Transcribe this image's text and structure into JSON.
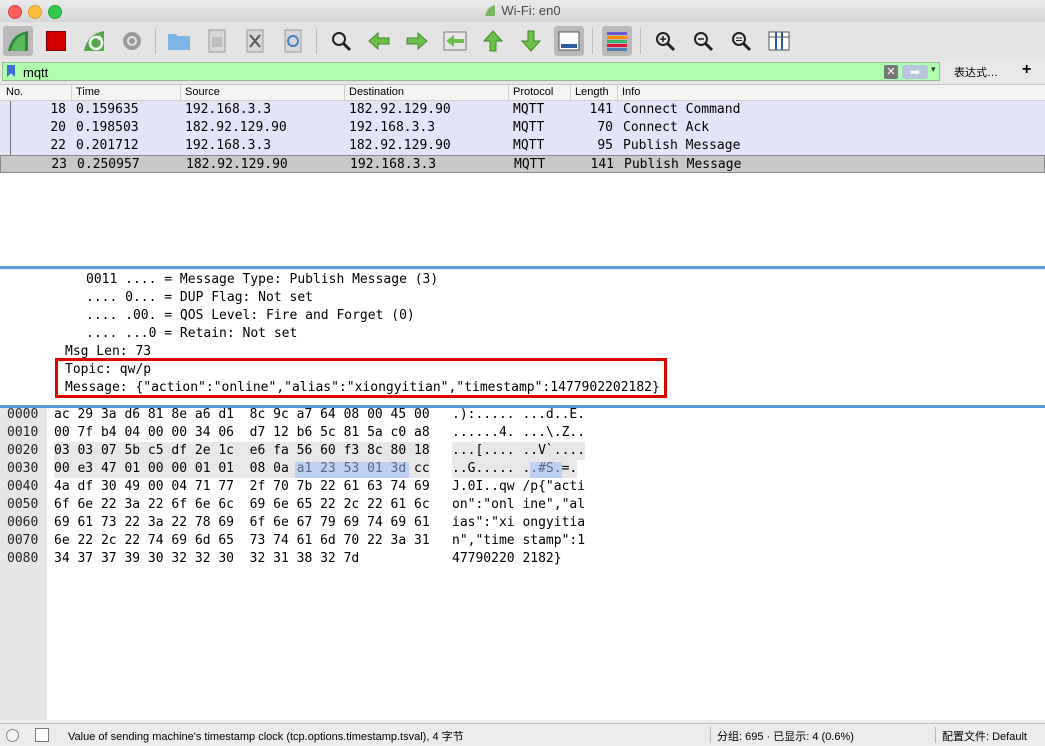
{
  "window": {
    "title": "Wi-Fi: en0"
  },
  "toolbar": {
    "icons": [
      "shark-fin-start-icon",
      "stop-square-icon",
      "restart-icon",
      "capture-options-gear-icon",
      "open-folder-icon",
      "save-file-icon",
      "close-file-icon",
      "reload-icon",
      "find-magnifier-icon",
      "go-back-arrow-icon",
      "go-forward-arrow-icon",
      "go-to-packet-icon",
      "go-first-icon",
      "go-last-icon",
      "autoscroll-icon",
      "colorize-icon",
      "zoom-in-icon",
      "zoom-out-icon",
      "zoom-normal-icon",
      "resize-columns-icon"
    ]
  },
  "filter": {
    "value": "mqtt",
    "expression_label": "表达式…",
    "add_label": "+",
    "clear_label": "✕",
    "apply_label": "➡",
    "recent_label": "▾"
  },
  "columns": [
    "No.",
    "Time",
    "Source",
    "Destination",
    "Protocol",
    "Length",
    "Info"
  ],
  "packets": [
    {
      "no": "18",
      "time": "0.159635",
      "source": "192.168.3.3",
      "destination": "182.92.129.90",
      "protocol": "MQTT",
      "length": "141",
      "info": "Connect Command"
    },
    {
      "no": "20",
      "time": "0.198503",
      "source": "182.92.129.90",
      "destination": "192.168.3.3",
      "protocol": "MQTT",
      "length": "70",
      "info": "Connect Ack"
    },
    {
      "no": "22",
      "time": "0.201712",
      "source": "192.168.3.3",
      "destination": "182.92.129.90",
      "protocol": "MQTT",
      "length": "95",
      "info": "Publish Message"
    },
    {
      "no": "23",
      "time": "0.250957",
      "source": "182.92.129.90",
      "destination": "192.168.3.3",
      "protocol": "MQTT",
      "length": "141",
      "info": "Publish Message"
    }
  ],
  "details": [
    "0011 .... = Message Type: Publish Message (3)",
    ".... 0... = DUP Flag: Not set",
    ".... .00. = QOS Level: Fire and Forget (0)",
    ".... ...0 = Retain: Not set",
    "Msg Len: 73",
    "Topic: qw/p",
    "Message: {\"action\":\"online\",\"alias\":\"xiongyitian\",\"timestamp\":1477902202182}"
  ],
  "bytes": [
    {
      "offset": "0000",
      "hex": "ac 29 3a d6 81 8e a6 d1  8c 9c a7 64 08 00 45 00",
      "ascii": ".):..... ...d..E."
    },
    {
      "offset": "0010",
      "hex": "00 7f b4 04 00 00 34 06  d7 12 b6 5c 81 5a c0 a8",
      "ascii": "......4. ...\\.Z.."
    },
    {
      "offset": "0020",
      "hex": "03 03 07 5b c5 df 2e 1c  e6 fa 56 60 f3 8c 80 18",
      "ascii": "...[.... ..V`...."
    },
    {
      "offset": "0030",
      "hex": "00 e3 47 01 00 00 01 01  08 0a a1 23 53 01 3d cc",
      "ascii": "..G..... ..#S.=."
    },
    {
      "offset": "0040",
      "hex": "4a df 30 49 00 04 71 77  2f 70 7b 22 61 63 74 69",
      "ascii": "J.0I..qw /p{\"acti"
    },
    {
      "offset": "0050",
      "hex": "6f 6e 22 3a 22 6f 6e 6c  69 6e 65 22 2c 22 61 6c",
      "ascii": "on\":\"onl ine\",\"al"
    },
    {
      "offset": "0060",
      "hex": "69 61 73 22 3a 22 78 69  6f 6e 67 79 69 74 69 61",
      "ascii": "ias\":\"xi ongyitia"
    },
    {
      "offset": "0070",
      "hex": "6e 22 2c 22 74 69 6d 65  73 74 61 6d 70 22 3a 31",
      "ascii": "n\",\"time stamp\":1"
    },
    {
      "offset": "0080",
      "hex": "34 37 37 39 30 32 32 30  32 31 38 32 7d",
      "ascii": "47790220 2182}"
    }
  ],
  "status": {
    "field_info": "Value of sending machine's timestamp clock (tcp.options.timestamp.tsval), 4 字节",
    "packets": "分组: 695 · 已显示: 4 (0.6%)",
    "profile": "配置文件: Default"
  },
  "colors": {
    "filter_valid": "#afffaf",
    "row_bg": "#e4e4f8",
    "selected_row": "#c8c8c8",
    "highlight_box": "#e00000",
    "byte_highlight": "#9dbdf6"
  }
}
